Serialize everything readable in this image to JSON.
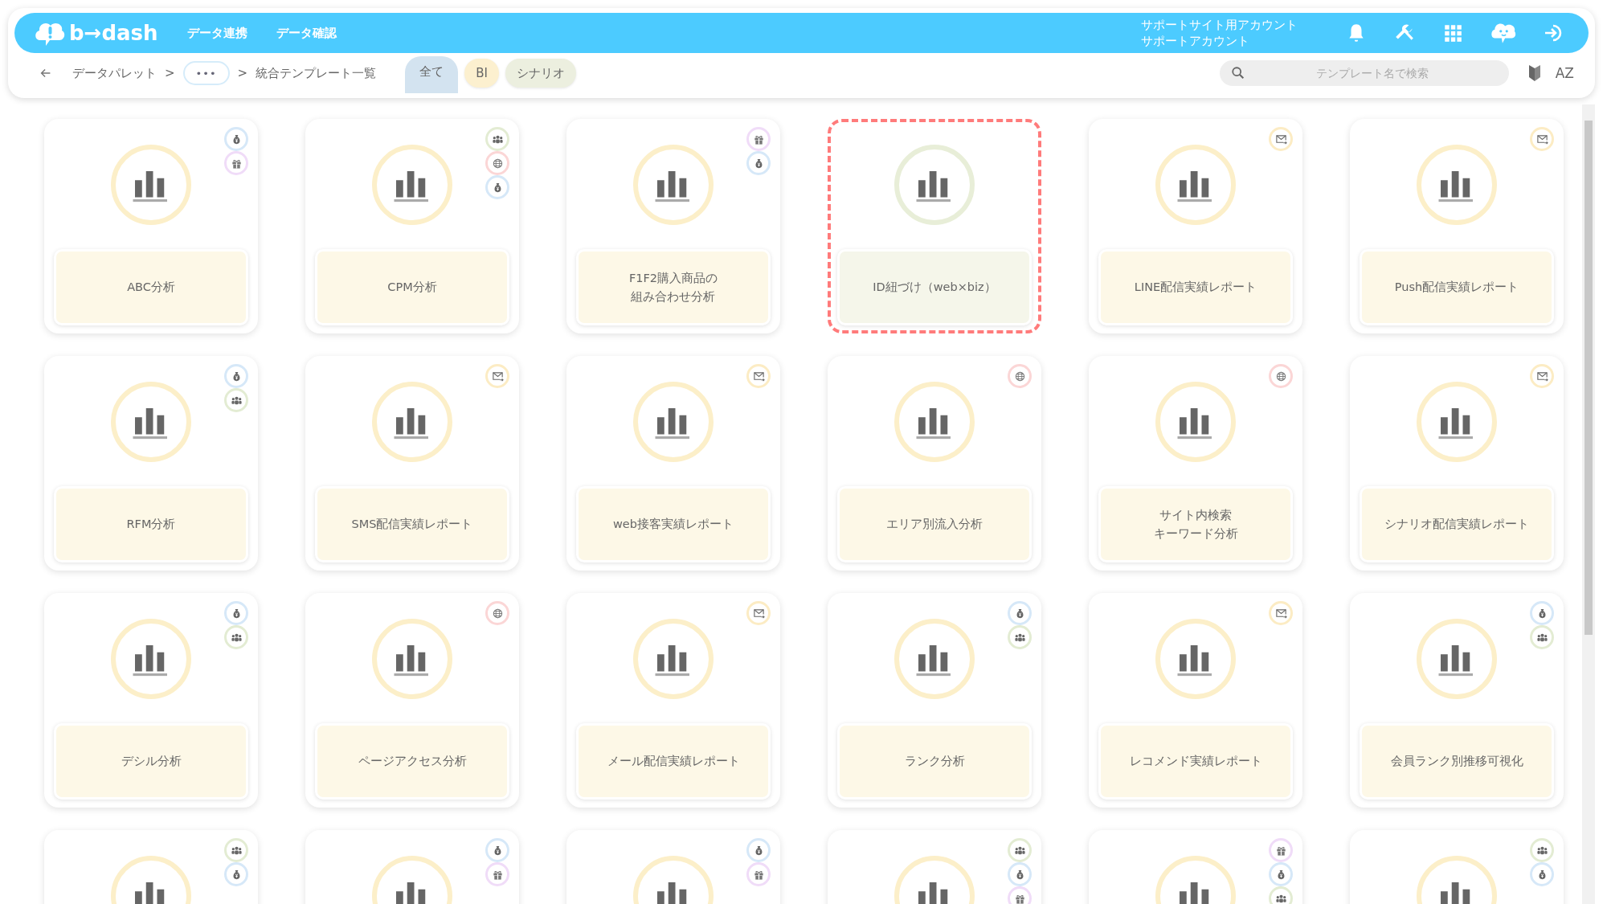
{
  "header": {
    "logo": "b→dash",
    "nav": [
      "データ連携",
      "データ確認"
    ],
    "account": [
      "サポートサイト用アカウント",
      "サポートアカウント"
    ]
  },
  "breadcrumb": {
    "items": [
      "データパレット",
      "統合テンプレート一覧"
    ],
    "separator": ">",
    "more": "•••"
  },
  "tabs": [
    {
      "label": "全て",
      "selected": true,
      "color": "#d3e3f0"
    },
    {
      "label": "BI",
      "selected": false,
      "color": "#fcf0cf"
    },
    {
      "label": "シナリオ",
      "selected": false,
      "color": "#ecefdf"
    }
  ],
  "search": {
    "placeholder": "テンプレート名で検索"
  },
  "sort_label": "AZ",
  "cards": [
    {
      "lines": [
        "ABC分析"
      ],
      "selected": false,
      "badges": [
        {
          "kind": "money"
        },
        {
          "kind": "gift"
        }
      ]
    },
    {
      "lines": [
        "CPM分析"
      ],
      "selected": false,
      "badges": [
        {
          "kind": "people"
        },
        {
          "kind": "globe"
        },
        {
          "kind": "money"
        }
      ]
    },
    {
      "lines": [
        "F1F2購入商品の",
        "組み合わせ分析"
      ],
      "selected": false,
      "badges": [
        {
          "kind": "gift"
        },
        {
          "kind": "money"
        }
      ]
    },
    {
      "lines": [
        "ID紐づけ（web×biz）"
      ],
      "selected": true
    },
    {
      "lines": [
        "LINE配信実績レポート"
      ],
      "selected": false,
      "badges": [
        {
          "kind": "mail"
        }
      ]
    },
    {
      "lines": [
        "Push配信実績レポート"
      ],
      "selected": false,
      "badges": [
        {
          "kind": "mail"
        }
      ]
    },
    {
      "lines": [
        "RFM分析"
      ],
      "selected": false,
      "badges": [
        {
          "kind": "money"
        },
        {
          "kind": "people"
        }
      ]
    },
    {
      "lines": [
        "SMS配信実績レポート"
      ],
      "selected": false,
      "badges": [
        {
          "kind": "mail"
        }
      ]
    },
    {
      "lines": [
        "web接客実績レポート"
      ],
      "selected": false,
      "badges": [
        {
          "kind": "mail"
        }
      ]
    },
    {
      "lines": [
        "エリア別流入分析"
      ],
      "selected": false,
      "badges": [
        {
          "kind": "globe"
        }
      ]
    },
    {
      "lines": [
        "サイト内検索",
        "キーワード分析"
      ],
      "selected": false,
      "badges": [
        {
          "kind": "globe"
        }
      ]
    },
    {
      "lines": [
        "シナリオ配信実績レポート"
      ],
      "selected": false,
      "badges": [
        {
          "kind": "mail"
        }
      ]
    },
    {
      "lines": [
        "デシル分析"
      ],
      "selected": false,
      "badges": [
        {
          "kind": "money"
        },
        {
          "kind": "people"
        }
      ]
    },
    {
      "lines": [
        "ページアクセス分析"
      ],
      "selected": false,
      "badges": [
        {
          "kind": "globe"
        }
      ]
    },
    {
      "lines": [
        "メール配信実績レポート"
      ],
      "selected": false,
      "badges": [
        {
          "kind": "mail"
        }
      ]
    },
    {
      "lines": [
        "ランク分析"
      ],
      "selected": false,
      "badges": [
        {
          "kind": "money"
        },
        {
          "kind": "people"
        }
      ]
    },
    {
      "lines": [
        "レコメンド実績レポート"
      ],
      "selected": false,
      "badges": [
        {
          "kind": "mail"
        }
      ]
    },
    {
      "lines": [
        "会員ランク別推移可視化"
      ],
      "selected": false,
      "badges": [
        {
          "kind": "money"
        },
        {
          "kind": "people"
        }
      ]
    },
    {
      "selected": false,
      "badges": [
        {
          "kind": "people"
        },
        {
          "kind": "money"
        }
      ]
    },
    {
      "selected": false,
      "badges": [
        {
          "kind": "money"
        },
        {
          "kind": "gift"
        }
      ]
    },
    {
      "selected": false,
      "badges": [
        {
          "kind": "money"
        },
        {
          "kind": "gift"
        }
      ]
    },
    {
      "selected": false,
      "badges": [
        {
          "kind": "people"
        },
        {
          "kind": "money"
        },
        {
          "kind": "gift"
        }
      ]
    },
    {
      "selected": false,
      "badges": [
        {
          "kind": "gift"
        },
        {
          "kind": "money"
        },
        {
          "kind": "people"
        }
      ]
    },
    {
      "selected": false,
      "badges": [
        {
          "kind": "people"
        },
        {
          "kind": "money"
        }
      ]
    }
  ]
}
